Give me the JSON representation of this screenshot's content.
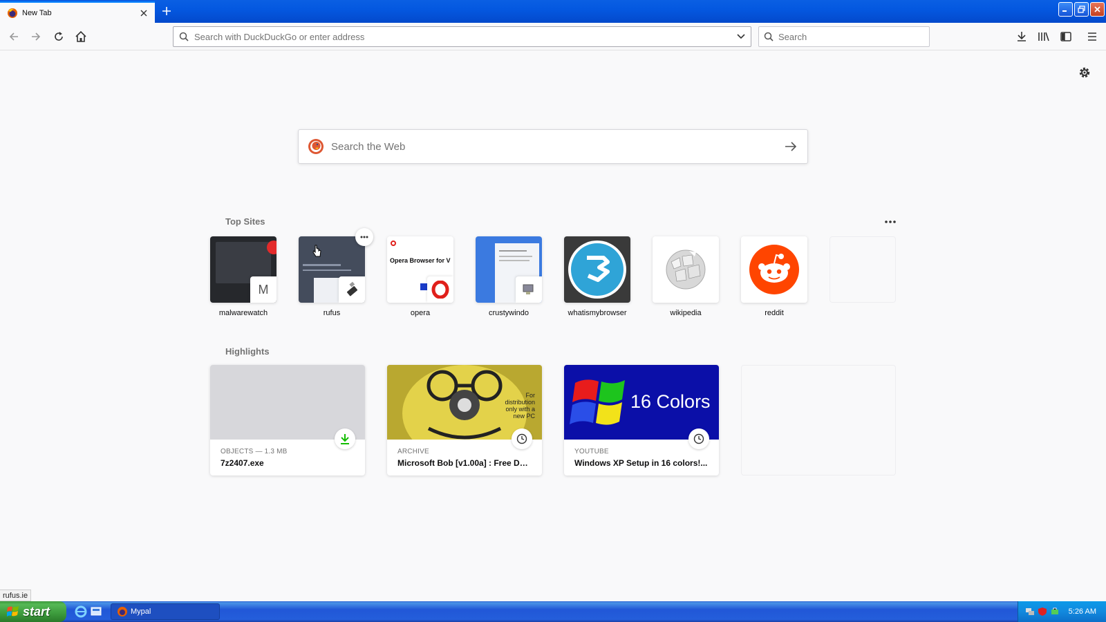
{
  "tab": {
    "title": "New Tab",
    "favicon": "firefox-logo"
  },
  "window_controls": [
    "minimize",
    "restore",
    "close"
  ],
  "toolbar": {
    "url_placeholder": "Search with DuckDuckGo or enter address",
    "search_placeholder": "Search",
    "icons": [
      "back-arrow",
      "forward-arrow",
      "reload",
      "home",
      "download",
      "library",
      "sidebar",
      "menu"
    ]
  },
  "newtab": {
    "web_search_placeholder": "Search the Web",
    "top_sites_title": "Top Sites",
    "highlights_title": "Highlights",
    "top_sites": [
      {
        "label": "malwarewatch",
        "letter": "M"
      },
      {
        "label": "rufus"
      },
      {
        "label": "opera",
        "snippet": "Opera Browser for V"
      },
      {
        "label": "crustywindo"
      },
      {
        "label": "whatismybrowser"
      },
      {
        "label": "wikipedia"
      },
      {
        "label": "reddit"
      },
      {
        "label": ""
      }
    ],
    "highlights": [
      {
        "context": "OBJECTS — 1.3 MB",
        "title": "7z2407.exe",
        "badge": "download-icon"
      },
      {
        "context": "ARCHIVE",
        "title": "Microsoft Bob [v1.00a] : Free Do...",
        "badge": "clock-icon",
        "image_text": "For distribution only with a new PC"
      },
      {
        "context": "YOUTUBE",
        "title": "Windows XP Setup in 16 colors!...",
        "badge": "clock-icon",
        "image_text": "16 Colors"
      },
      {
        "context": "",
        "title": ""
      }
    ]
  },
  "status_url": "rufus.ie",
  "taskbar": {
    "start_label": "start",
    "task_label": "Mypal",
    "clock": "5:26 AM"
  },
  "colors": {
    "accent": "#0a84ff",
    "reddit": "#ff4500",
    "whatismybrowser": "#2fa4d7",
    "xp_blue": "#245edb",
    "xp_green": "#3c9a3c"
  }
}
